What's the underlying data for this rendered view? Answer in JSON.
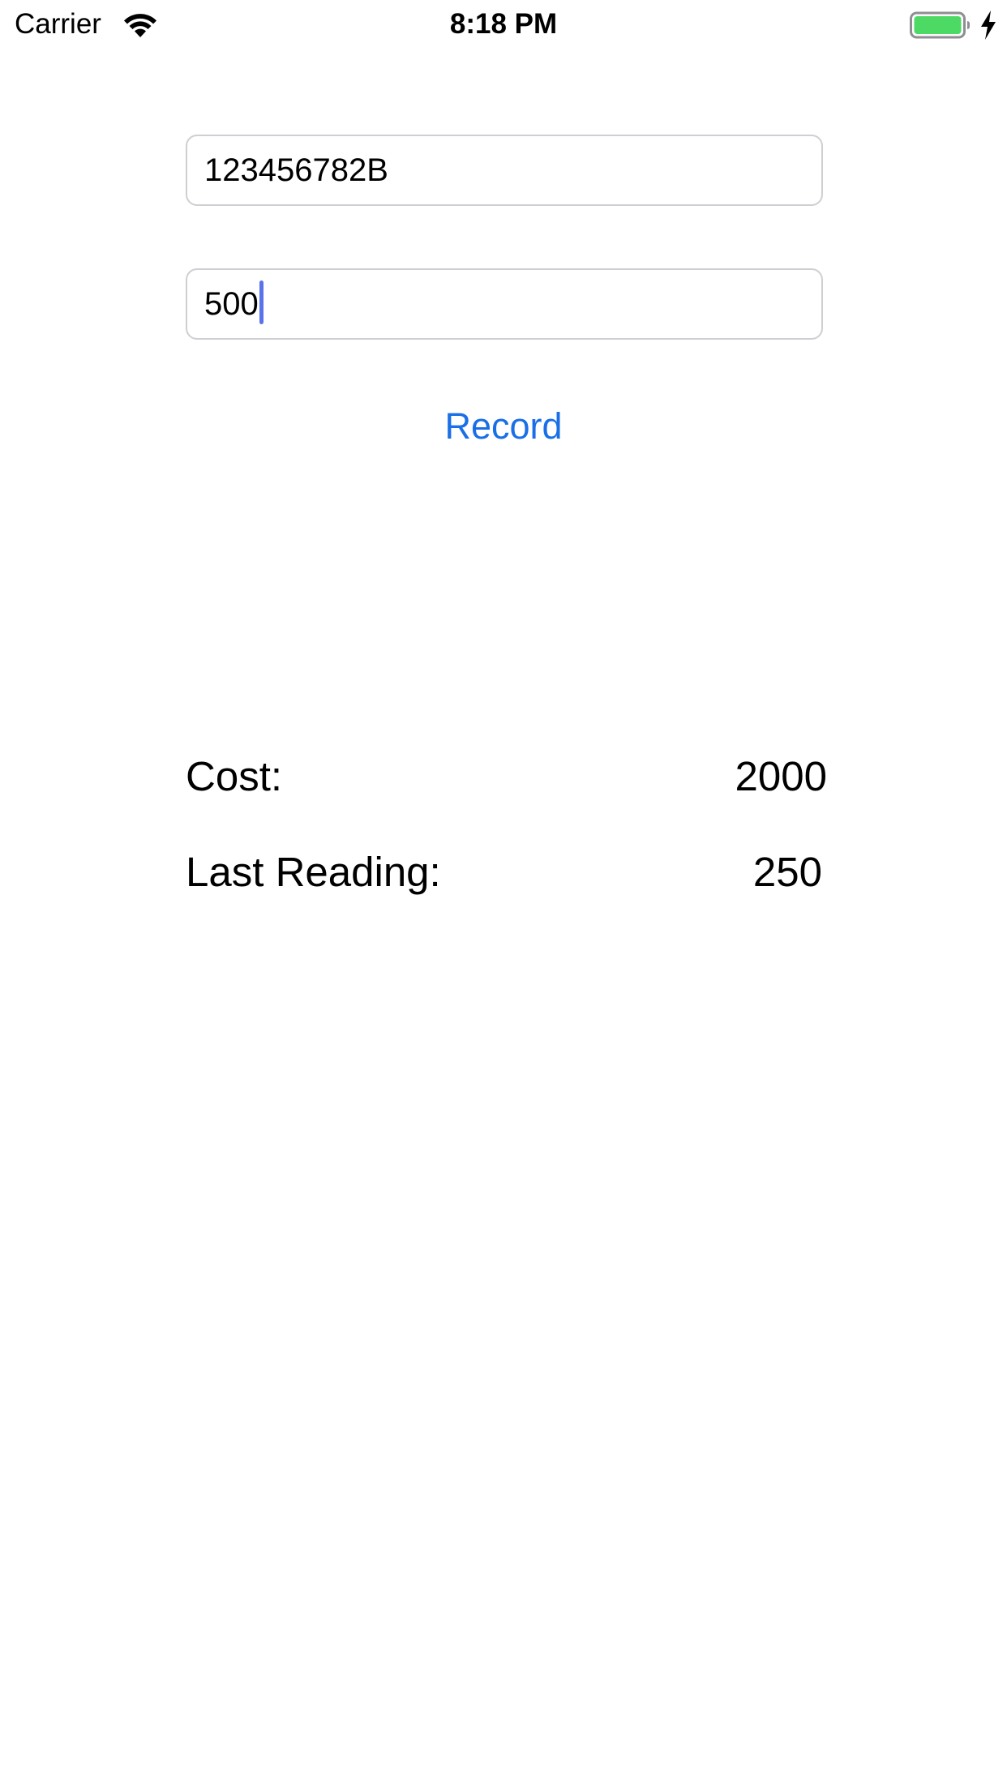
{
  "status_bar": {
    "carrier": "Carrier",
    "time": "8:18 PM",
    "battery_color": "#4cd964",
    "icons": [
      "wifi-icon",
      "battery-icon",
      "charging-bolt-icon"
    ]
  },
  "form": {
    "meter_id_value": "123456782B",
    "reading_value": "500",
    "record_label": "Record",
    "accent_color": "#1a6fe6"
  },
  "results": {
    "cost_label": "Cost:",
    "cost_value": "2000",
    "last_reading_label": "Last Reading:",
    "last_reading_value": "250"
  }
}
